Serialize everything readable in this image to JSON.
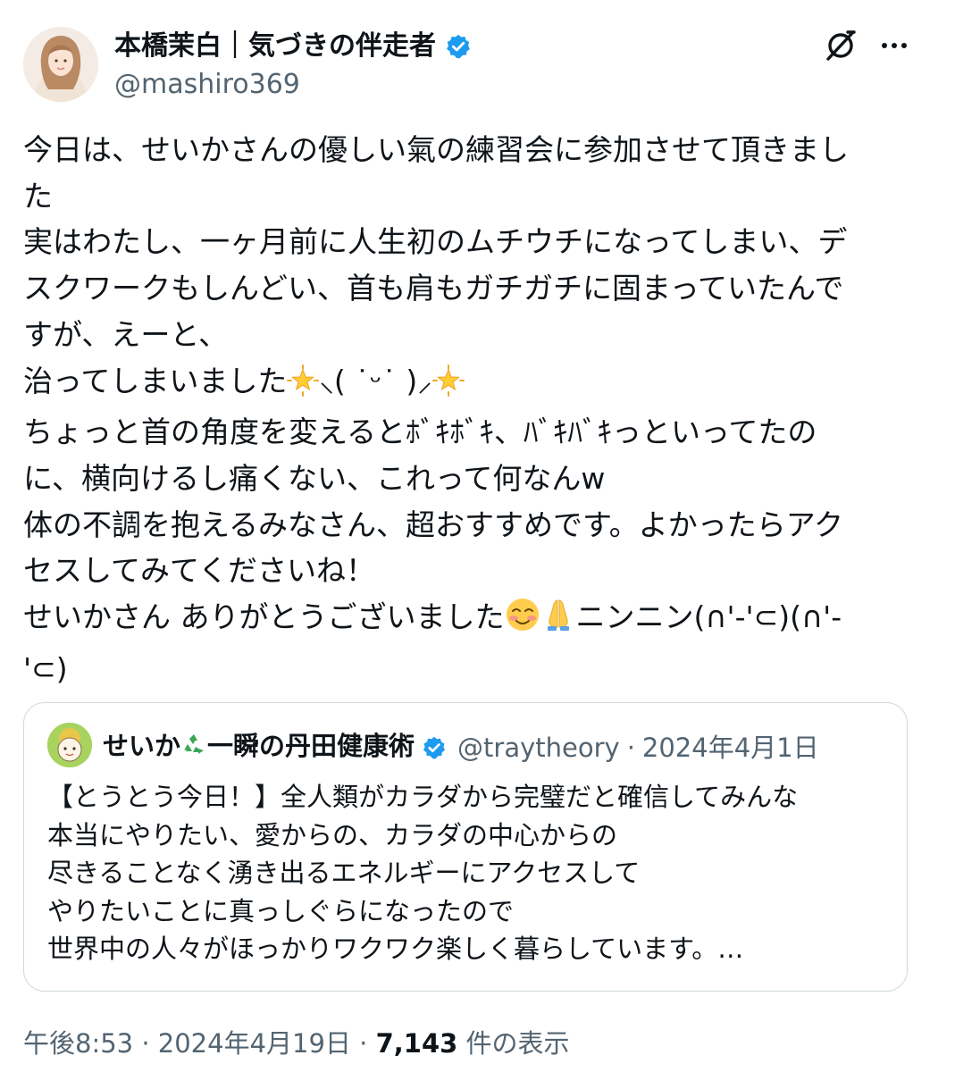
{
  "author": {
    "display_name": "本橋茉白｜気づきの伴走者",
    "handle": "@mashiro369",
    "verified": true
  },
  "icons": {
    "verified": "verified-badge-icon",
    "grok": "grok-icon",
    "more": "more-options-icon"
  },
  "tweet": {
    "lines": [
      "今日は、せいかさんの優しい氣の練習会に参加させて頂きまし",
      "た",
      "実はわたし、一ヶ月前に人生初のムチウチになってしまい、デ",
      "スクワークもしんどい、首も肩もガチガチに固まっていたんで",
      "すが、えーと、",
      "治ってしまいました",
      "ちょっと首の角度を変えるとﾎﾞｷﾎﾞｷ、ﾊﾞｷﾊﾞｷっといってたの",
      "に、横向けるし痛くない、これって何なんw",
      "体の不調を抱えるみなさん、超おすすめです。よかったらアク",
      "セスしてみてくださいね！",
      "せいかさん ありがとうございました",
      "'⊂)"
    ],
    "kaomoji": "⸜( ˙ᵕ˙ )⸝",
    "niniin": "ニンニン(∩'-'⊂)(∩'-"
  },
  "quote": {
    "name_part1": "せいか",
    "name_part2": "一瞬の丹田健康術",
    "handle": "@traytheory",
    "separator": "·",
    "date": "2024年4月1日",
    "lines": [
      "【とうとう今日！】全人類がカラダから完璧だと確信してみんな",
      "本当にやりたい、愛からの、カラダの中心からの",
      "尽きることなく湧き出るエネルギーにアクセスして",
      "やりたいことに真っしぐらになったので",
      "世界中の人々がほっかりワクワク楽しく暮らしています。…"
    ]
  },
  "meta": {
    "time": "午後8:53",
    "sep1": "·",
    "date": "2024年4月19日",
    "sep2": "·",
    "views": "7,143",
    "views_suffix": "件の表示"
  },
  "colors": {
    "text": "#0f1419",
    "secondary": "#536471",
    "verified_blue": "#1d9bf0",
    "border": "#cfd9de"
  }
}
